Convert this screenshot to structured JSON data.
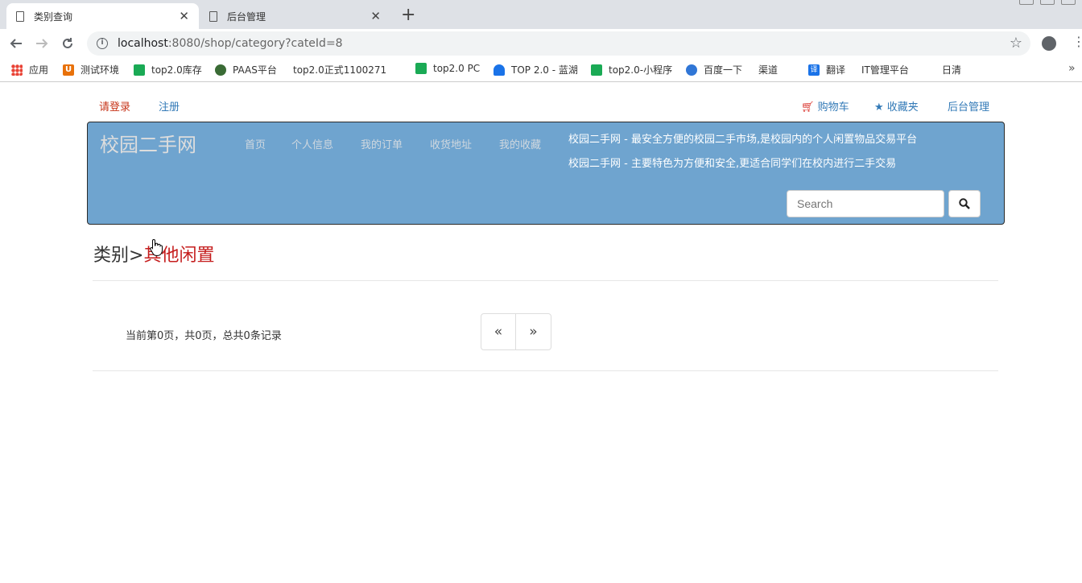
{
  "browser": {
    "tabs": [
      {
        "label": "类别查询",
        "close": "✕"
      },
      {
        "label": "后台管理",
        "close": "✕"
      }
    ],
    "newtab": "+",
    "url": {
      "host": "localhost",
      "rest": ":8080/shop/category?cateId=8"
    },
    "bookmarks": [
      {
        "label": "应用",
        "icon": "apps-grid-icon"
      },
      {
        "label": "测试环境",
        "icon": "u-logo-icon"
      },
      {
        "label": "top2.0库存",
        "icon": "play-icon"
      },
      {
        "label": "PAAS平台",
        "icon": "circle-logo-icon"
      },
      {
        "label": "top2.0正式1100271",
        "icon": "page-icon"
      },
      {
        "label": "top2.0 PC",
        "icon": "play-icon"
      },
      {
        "label": "TOP 2.0 - 蓝湖",
        "icon": "lanhu-icon"
      },
      {
        "label": "top2.0-小程序",
        "icon": "play-icon"
      },
      {
        "label": "百度一下",
        "icon": "baidu-paw-icon"
      },
      {
        "label": "渠道",
        "icon": "page-icon"
      },
      {
        "label": "翻译",
        "icon": "translate-icon"
      },
      {
        "label": "IT管理平台",
        "icon": "page-icon"
      },
      {
        "label": "日清",
        "icon": "page-icon"
      }
    ]
  },
  "topbar": {
    "login": "请登录",
    "register": "注册",
    "cart": "购物车",
    "favorites": "收藏夹",
    "admin": "后台管理"
  },
  "banner": {
    "brand": "校园二手网",
    "nav": [
      "首页",
      "个人信息",
      "我的订单",
      "收货地址",
      "我的收藏"
    ],
    "slogan1": "校园二手网 - 最安全方便的校园二手市场,是校园内的个人闲置物品交易平台",
    "slogan2": "校园二手网 - 主要特色为方便和安全,更适合同学们在校内进行二手交易",
    "search_placeholder": "Search",
    "color": "#6fa4cf"
  },
  "breadcrumb": {
    "prefix": "类别>",
    "current": "其他闲置"
  },
  "pagination": {
    "info": "当前第0页，共0页，总共0条记录",
    "prev": "«",
    "next": "»"
  }
}
